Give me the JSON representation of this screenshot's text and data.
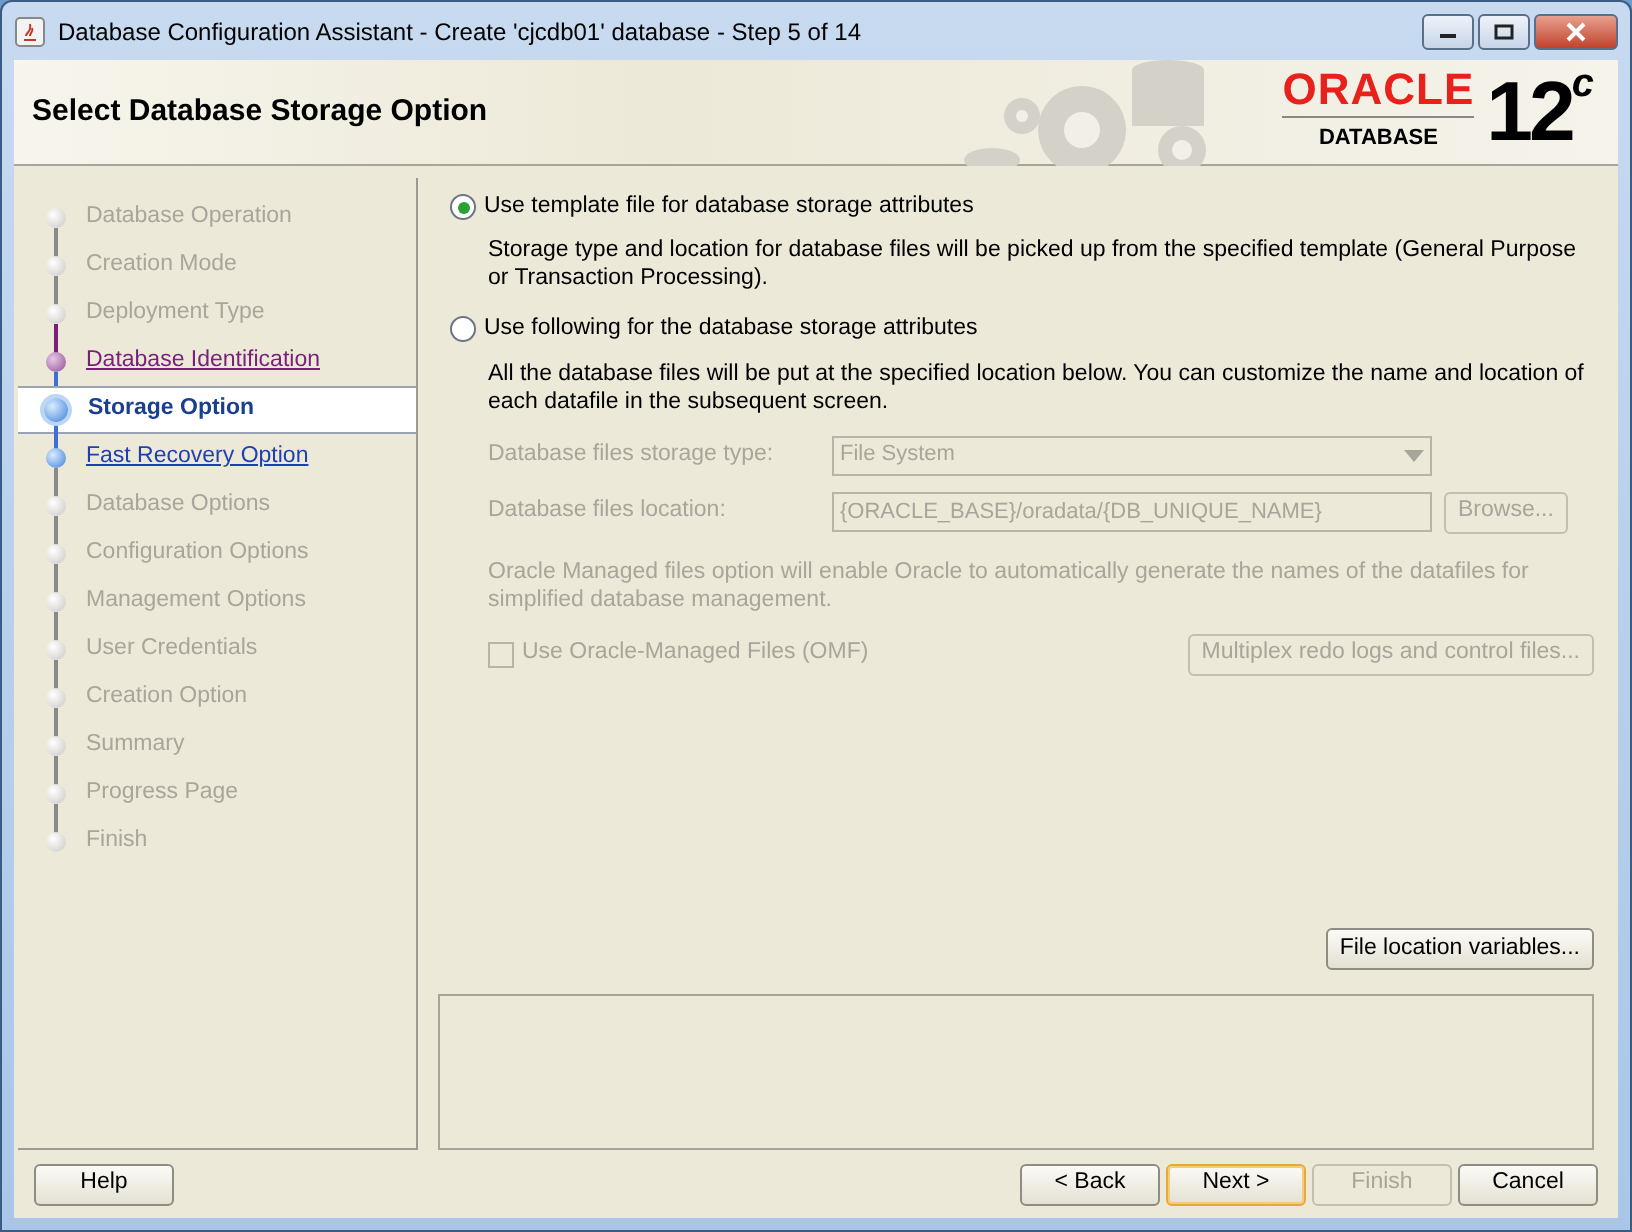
{
  "window": {
    "title": "Database Configuration Assistant - Create 'cjcdb01' database - Step 5 of 14"
  },
  "header": {
    "title": "Select Database Storage Option",
    "logo_brand": "ORACLE",
    "logo_product": "DATABASE",
    "logo_version": "12",
    "logo_suffix": "c"
  },
  "steps": [
    {
      "label": "Database Operation",
      "kind": "pending"
    },
    {
      "label": "Creation Mode",
      "kind": "pending"
    },
    {
      "label": "Deployment Type",
      "kind": "pending"
    },
    {
      "label": "Database Identification",
      "kind": "visited"
    },
    {
      "label": "Storage Option",
      "kind": "current"
    },
    {
      "label": "Fast Recovery Option",
      "kind": "next"
    },
    {
      "label": "Database Options",
      "kind": "pending"
    },
    {
      "label": "Configuration Options",
      "kind": "pending"
    },
    {
      "label": "Management Options",
      "kind": "pending"
    },
    {
      "label": "User Credentials",
      "kind": "pending"
    },
    {
      "label": "Creation Option",
      "kind": "pending"
    },
    {
      "label": "Summary",
      "kind": "pending"
    },
    {
      "label": "Progress Page",
      "kind": "pending"
    },
    {
      "label": "Finish",
      "kind": "pending"
    }
  ],
  "options": [
    {
      "label": "Use template file for database storage attributes",
      "selected": true,
      "description": "Storage type and location for database files will be picked up from the specified template (General Purpose or Transaction Processing)."
    },
    {
      "label": "Use following for the database storage attributes",
      "selected": false,
      "description": "All the database files will be put at the specified location below. You can customize the name and location of each datafile in the subsequent screen."
    }
  ],
  "storage_type": {
    "label": "Database files storage type:",
    "value": "File System",
    "disabled": true
  },
  "files_location": {
    "label": "Database files location:",
    "value": "{ORACLE_BASE}/oradata/{DB_UNIQUE_NAME}",
    "disabled": true,
    "browse_button": "Browse..."
  },
  "omf_note": "Oracle Managed files option will enable Oracle to automatically generate the names of the datafiles for simplified database management.",
  "omf_checkbox": {
    "label": "Use Oracle-Managed Files (OMF)",
    "checked": false,
    "disabled": true
  },
  "multiplex_button": {
    "label": "Multiplex redo logs and control files...",
    "disabled": true
  },
  "file_location_button": {
    "label": "File location variables...",
    "disabled": false
  },
  "buttons": [
    {
      "label": "Help",
      "kind": "left",
      "disabled": false,
      "default": false
    },
    {
      "label": "< Back",
      "kind": "right",
      "disabled": false,
      "default": false
    },
    {
      "label": "Next >",
      "kind": "right",
      "disabled": false,
      "default": true
    },
    {
      "label": "Finish",
      "kind": "right",
      "disabled": true,
      "default": false
    },
    {
      "label": "Cancel",
      "kind": "right",
      "disabled": false,
      "default": false
    }
  ]
}
